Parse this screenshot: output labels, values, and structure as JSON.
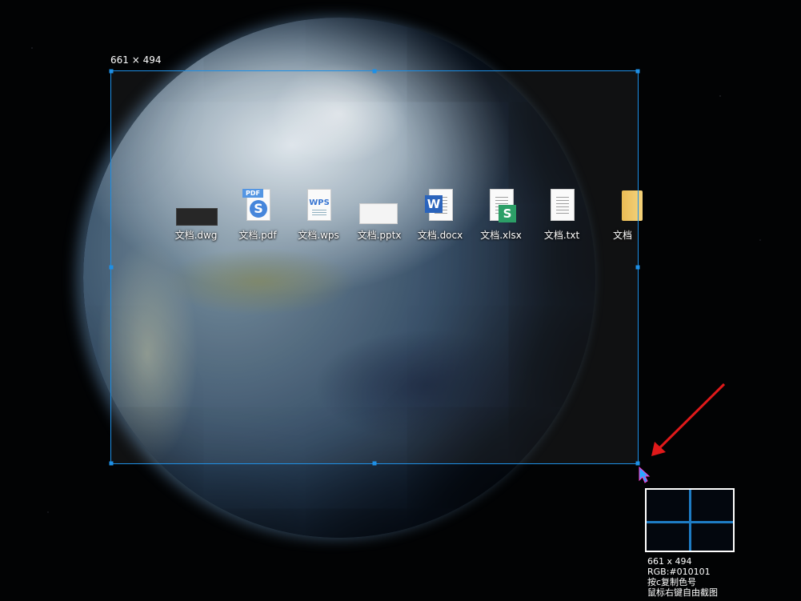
{
  "screenshot_tool": {
    "selection_size_label": "661 × 494",
    "info_panel": {
      "size": "661 x 494",
      "rgb": "RGB:#010101",
      "hint_copy": "按c复制色号",
      "hint_right_click": "鼠标右键自由截图"
    }
  },
  "desktop_icons": [
    {
      "label": "文档.dwg",
      "icon": "dwg-file-icon"
    },
    {
      "label": "文档.pdf",
      "icon": "pdf-file-icon"
    },
    {
      "label": "文档.wps",
      "icon": "wps-file-icon"
    },
    {
      "label": "文档.pptx",
      "icon": "pptx-file-icon"
    },
    {
      "label": "文档.docx",
      "icon": "word-file-icon"
    },
    {
      "label": "文档.xlsx",
      "icon": "sheet-file-icon"
    },
    {
      "label": "文档.txt",
      "icon": "text-file-icon"
    },
    {
      "label": "文档",
      "icon": "folder-icon"
    }
  ],
  "icon_text": {
    "pdf": "PDF",
    "wps": "WPS",
    "word": "W",
    "sheet": "S"
  },
  "colors": {
    "selection_border": "#1e90e6",
    "annotation_arrow": "#e0191a",
    "crosshair": "#1e7cc4"
  }
}
